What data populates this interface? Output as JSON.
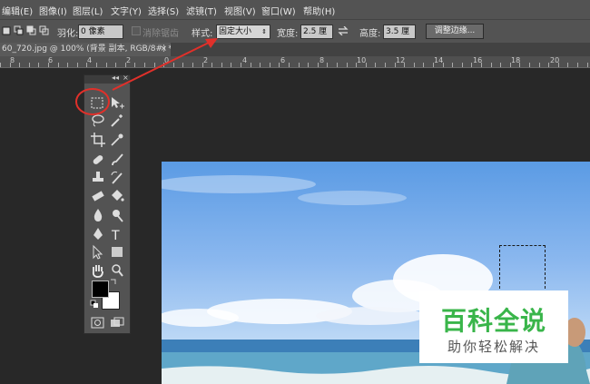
{
  "menu": {
    "items": [
      "编辑(E)",
      "图像(I)",
      "图层(L)",
      "文字(Y)",
      "选择(S)",
      "滤镜(T)",
      "视图(V)",
      "窗口(W)",
      "帮助(H)"
    ]
  },
  "options": {
    "feather_label": "羽化:",
    "feather_value": "0 像素",
    "antialias_label": "消除锯齿",
    "style_label": "样式:",
    "style_value": "固定大小",
    "width_label": "宽度:",
    "width_value": "2.5 厘",
    "height_label": "高度:",
    "height_value": "3.5 厘",
    "refine_edge_label": "调整边缘..."
  },
  "document": {
    "tab_title": "60_720.jpg @ 100% (背景 副本, RGB/8#) *",
    "close_glyph": "×"
  },
  "ruler": {
    "labels": [
      "8",
      "6",
      "4",
      "2",
      "0",
      "2",
      "4",
      "6",
      "8",
      "10",
      "12",
      "14",
      "16",
      "18",
      "20"
    ]
  },
  "toolbox": {
    "collapse_glyph": "◂◂",
    "close_glyph": "×"
  },
  "watermark": {
    "main": "百科全说",
    "sub": "助你轻松解决"
  },
  "colors": {
    "annotation_red": "#e0302a",
    "watermark_green": "#39b54a",
    "foreground": "#000000",
    "background": "#ffffff"
  }
}
